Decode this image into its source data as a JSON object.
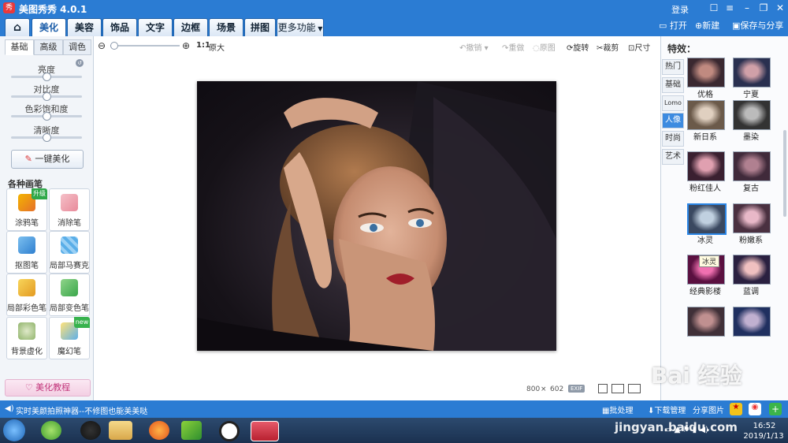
{
  "window": {
    "app_title": "美图秀秀 4.0.1",
    "login": "登录"
  },
  "menu": {
    "items": [
      "美化",
      "美容",
      "饰品",
      "文字",
      "边框",
      "场景",
      "拼图",
      "更多功能"
    ],
    "open": "打开",
    "new": "新建",
    "save_share": "保存与分享"
  },
  "left_panel": {
    "tabs": [
      "基础",
      "高级",
      "调色"
    ],
    "sliders": [
      {
        "label": "亮度",
        "value": 0.5
      },
      {
        "label": "对比度",
        "value": 0.5
      },
      {
        "label": "色彩饱和度",
        "value": 0.5
      },
      {
        "label": "清晰度",
        "value": 0.5
      }
    ],
    "one_click": "一键美化",
    "brushes_title": "各种画笔",
    "tools": [
      {
        "label": "涂鸦笔",
        "badge": "升级"
      },
      {
        "label": "消除笔",
        "badge": ""
      },
      {
        "label": "抠图笔",
        "badge": ""
      },
      {
        "label": "局部马赛克",
        "badge": ""
      },
      {
        "label": "局部彩色笔",
        "badge": ""
      },
      {
        "label": "局部变色笔",
        "badge": ""
      },
      {
        "label": "背景虚化",
        "badge": ""
      },
      {
        "label": "魔幻笔",
        "badge": "new"
      }
    ],
    "tutorial": "美化教程"
  },
  "toolbar": {
    "zoom_ratio": "1:1",
    "original_size": "原大",
    "undo": "撤销",
    "redo": "重做",
    "restore": "原图",
    "rotate": "旋转",
    "crop": "裁剪",
    "resize": "尺寸"
  },
  "canvas": {
    "width": "800",
    "times": "×",
    "height": "602",
    "exif": "EXIF"
  },
  "right_panel": {
    "title": "特效：",
    "categories": [
      "热门",
      "基础",
      "Lomo",
      "人像",
      "时尚",
      "艺术"
    ],
    "active_category": "人像",
    "effects": [
      "优格",
      "宁夏",
      "新日系",
      "墨染",
      "粉红佳人",
      "复古",
      "冰灵",
      "粉嫩系",
      "经典影楼",
      "蓝调",
      "",
      ""
    ],
    "tooltip": "冰灵"
  },
  "statusbar": {
    "message": "实时美颜拍照神器--不修图也能美美哒",
    "batch": "批处理",
    "download": "下载管理",
    "share": "分享图片"
  },
  "taskbar": {
    "time": "16:52",
    "date": "2019/1/13"
  },
  "watermark": {
    "text": "Bai 经验",
    "sub": "jingyan.baidu.com"
  }
}
